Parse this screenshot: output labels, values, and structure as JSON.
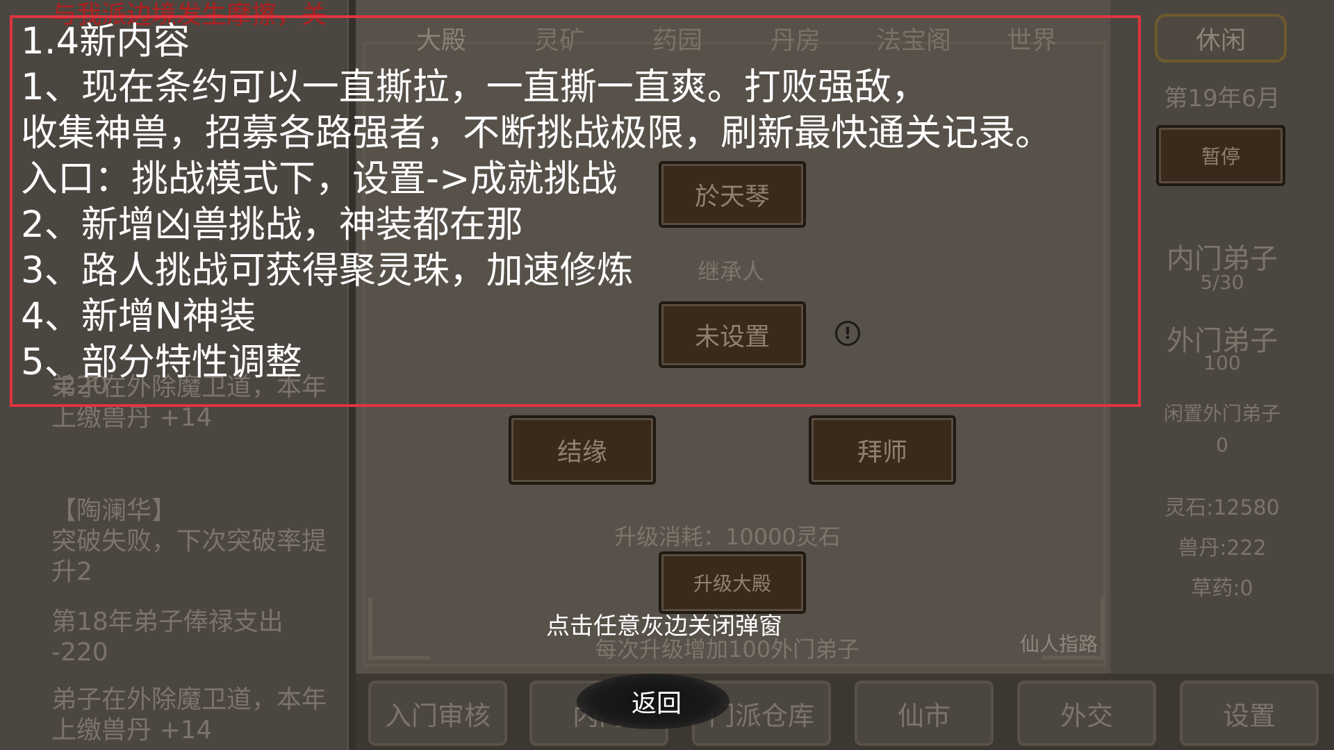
{
  "log": {
    "red_line": "与我派边境发生摩擦，关",
    "entries": [
      {
        "lines": [
          "弟子在外除魔卫道，本年",
          "上缴兽丹 +14"
        ]
      },
      {
        "lines": [
          "【陶澜华】",
          "突破失败，下次突破率提",
          "升2"
        ]
      },
      {
        "lines": [
          "第18年弟子俸禄支出",
          "-220"
        ]
      },
      {
        "lines": [
          "弟子在外除魔卫道，本年",
          "上缴兽丹 +14"
        ]
      }
    ],
    "hidden_fragment": "-220"
  },
  "tabs": [
    "大殿",
    "灵矿",
    "药园",
    "丹房",
    "法宝阁",
    "世界"
  ],
  "hall": {
    "master_name": "於天琴",
    "heir_label": "继承人",
    "heir_value": "未设置",
    "bond_button": "结缘",
    "apprentice_button": "拜师",
    "upgrade_cost": "升级消耗：10000灵石",
    "upgrade_button": "升级大殿",
    "upgrade_note": "每次升级增加100外门弟子"
  },
  "right_panel": {
    "leisure_button": "休闲",
    "date": "第19年6月",
    "pause_button": "暂停",
    "inner_label": "内门弟子",
    "inner_value": "5/30",
    "outer_label": "外门弟子",
    "outer_value": "100",
    "idle_label": "闲置外门弟子",
    "idle_value": "0",
    "spirit_stone": "灵石:12580",
    "beast_pill": "兽丹:222",
    "herbs": "草药:0"
  },
  "bottom_bar": [
    "入门审核",
    "内门",
    "门派仓库",
    "仙市",
    "外交",
    "设置"
  ],
  "popup": {
    "lines": [
      "1.4新内容",
      "1、现在条约可以一直撕拉，一直撕一直爽。打败强敌，",
      "收集神兽，招募各路强者，不断挑战极限，刷新最快通关记录。",
      "入口：挑战模式下，设置->成就挑战",
      "2、新增凶兽挑战，神装都在那",
      "3、路人挑战可获得聚灵珠，加速修炼",
      "4、新增N神装",
      "5、部分特性调整"
    ],
    "close_hint": "点击任意灰边关闭弹窗",
    "return_button": "返回",
    "border_color": "#e03540"
  },
  "watermark": "仙人指路"
}
